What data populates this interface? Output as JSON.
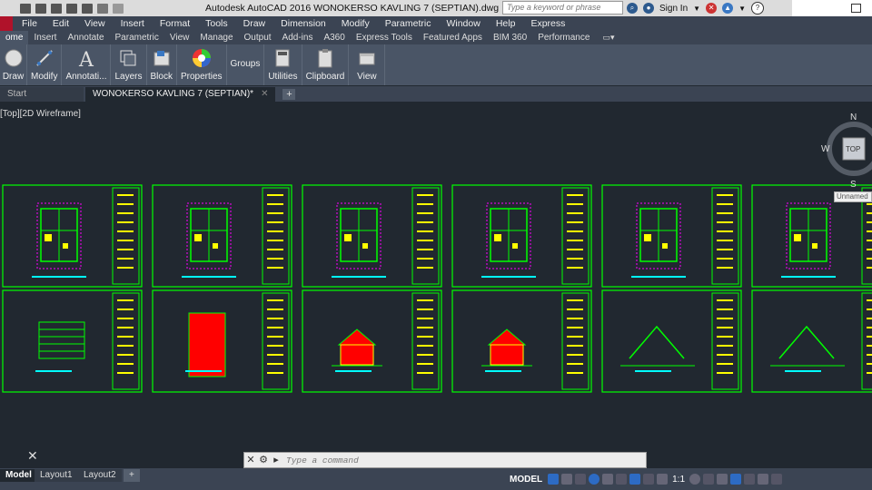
{
  "titlebar": {
    "title": "Autodesk AutoCAD 2016    WONOKERSO KAVLING 7 (SEPTIAN).dwg",
    "search_placeholder": "Type a keyword or phrase",
    "sign_in": "Sign In"
  },
  "menubar": [
    "File",
    "Edit",
    "View",
    "Insert",
    "Format",
    "Tools",
    "Draw",
    "Dimension",
    "Modify",
    "Parametric",
    "Window",
    "Help",
    "Express"
  ],
  "ribbon_tabs": [
    {
      "label": "ome",
      "active": true
    },
    {
      "label": "Insert"
    },
    {
      "label": "Annotate"
    },
    {
      "label": "Parametric"
    },
    {
      "label": "View"
    },
    {
      "label": "Manage"
    },
    {
      "label": "Output"
    },
    {
      "label": "Add-ins"
    },
    {
      "label": "A360"
    },
    {
      "label": "Express Tools"
    },
    {
      "label": "Featured Apps"
    },
    {
      "label": "BIM 360"
    },
    {
      "label": "Performance"
    }
  ],
  "ribbon_panels": [
    {
      "label": "Draw",
      "icon": "draw-icon"
    },
    {
      "label": "Modify",
      "icon": "modify-icon"
    },
    {
      "label": "Annotati...",
      "icon": "annotation-icon"
    },
    {
      "label": "Layers",
      "icon": "layers-icon"
    },
    {
      "label": "Block",
      "icon": "block-icon"
    },
    {
      "label": "Properties",
      "icon": "properties-icon"
    },
    {
      "label": "Groups",
      "icon": "groups-icon"
    },
    {
      "label": "Utilities",
      "icon": "utilities-icon"
    },
    {
      "label": "Clipboard",
      "icon": "clipboard-icon"
    },
    {
      "label": "View",
      "icon": "view-icon"
    }
  ],
  "file_tabs": [
    {
      "label": "Start",
      "active": false
    },
    {
      "label": "WONOKERSO KAVLING 7 (SEPTIAN)*",
      "active": true
    }
  ],
  "viewport": {
    "label": "[Top][2D Wireframe]",
    "viewcube": {
      "n": "N",
      "s": "S",
      "w": "W",
      "face": "TOP"
    },
    "ucs_tooltip": "Unnamed"
  },
  "command": {
    "placeholder": "Type  a  command"
  },
  "layout_tabs": [
    {
      "label": "Model",
      "active": true
    },
    {
      "label": "Layout1"
    },
    {
      "label": "Layout2"
    }
  ],
  "status": {
    "model": "MODEL",
    "scale": "1:1"
  },
  "colors": {
    "drawing": "#00ff00",
    "highlight": "#ffff00",
    "accent": "#ff00ff",
    "cyan": "#00ffff",
    "fill": "#ff0000"
  }
}
